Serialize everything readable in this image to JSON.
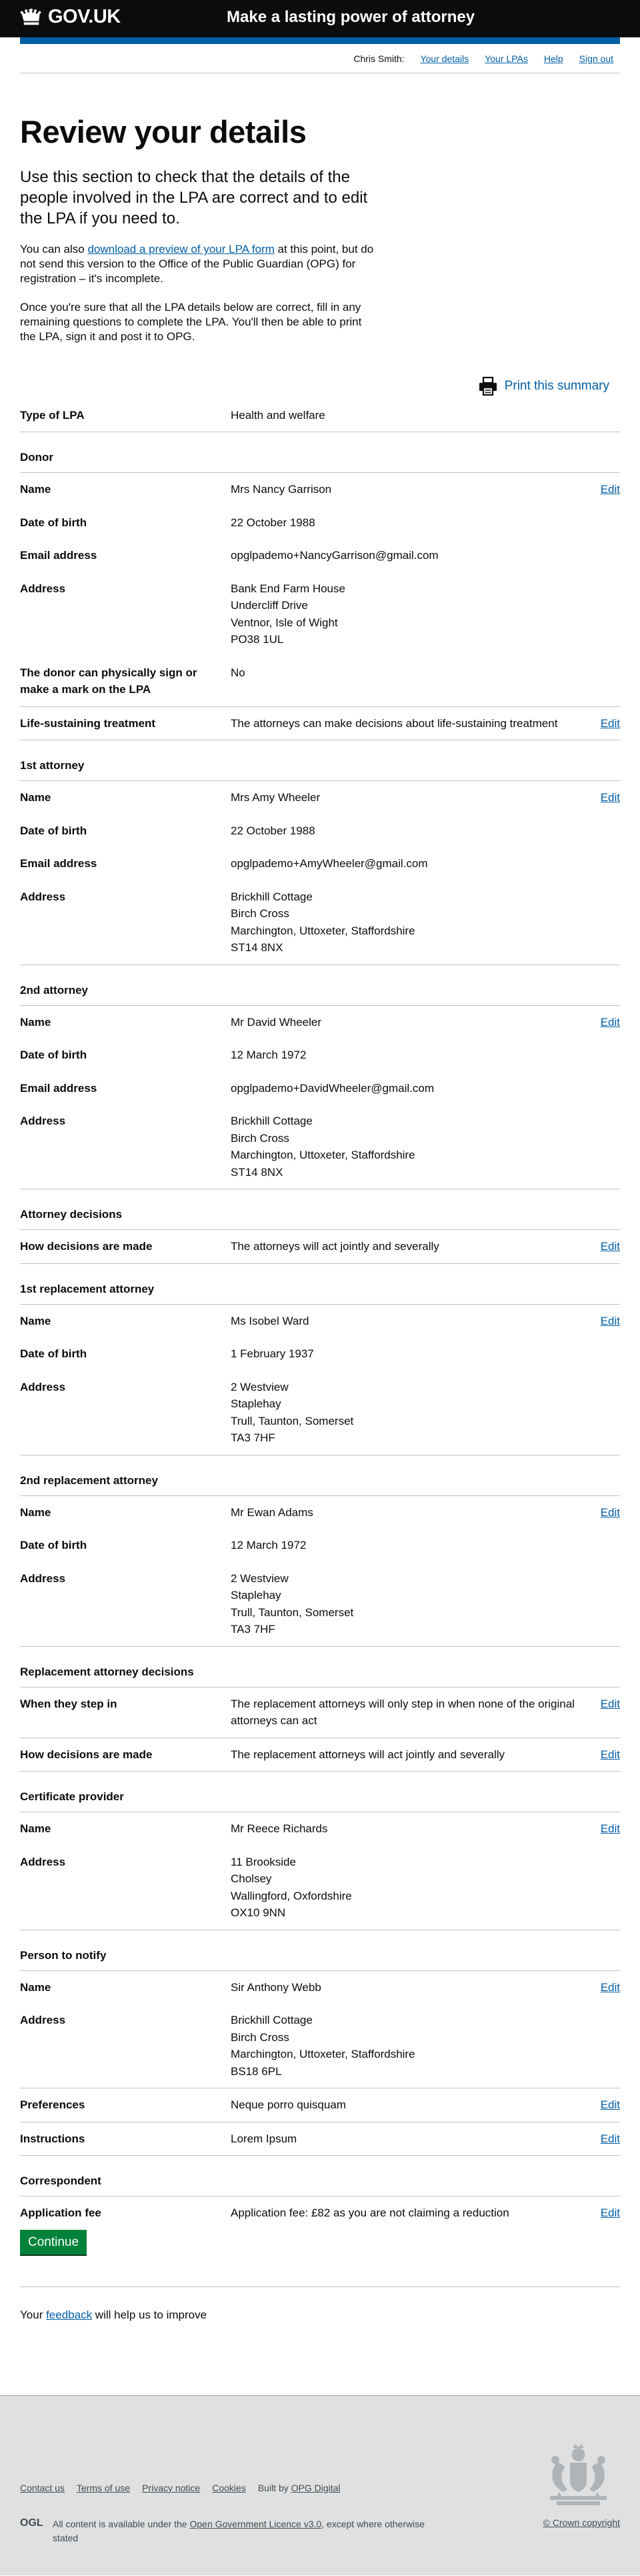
{
  "header": {
    "logo_text": "GOV.UK",
    "service_name": "Make a lasting power of attorney"
  },
  "user_nav": {
    "user_name": "Chris Smith:",
    "links": [
      "Your details",
      "Your LPAs",
      "Help",
      "Sign out"
    ]
  },
  "page": {
    "title": "Review your details",
    "lede": "Use this section to check that the details of the people involved in the LPA are correct and to edit the LPA if you need to.",
    "para1_before": "You can also ",
    "para1_link": "download a preview of your LPA form",
    "para1_after": " at this point, but do not send this version to the Office of the Public Guardian (OPG) for registration – it's incomplete.",
    "para2": "Once you're sure that all the LPA details below are correct, fill in any remaining questions to complete the LPA. You'll then be able to print the LPA, sign it and post it to OPG.",
    "print_label": "Print this summary",
    "edit_label": "Edit",
    "continue_label": "Continue",
    "feedback_before": "Your ",
    "feedback_link": "feedback",
    "feedback_after": " will help us to improve"
  },
  "type_of_lpa": {
    "label": "Type of LPA",
    "value": "Health and welfare"
  },
  "donor": {
    "heading": "Donor",
    "name": "Mrs Nancy Garrison",
    "dob": "22 October 1988",
    "email": "opglpademo+NancyGarrison@gmail.com",
    "address": [
      "Bank End Farm House",
      "Undercliff Drive",
      "Ventnor, Isle of Wight",
      "PO38 1UL"
    ],
    "sign_label": "The donor can physically sign or make a mark on the LPA",
    "sign_value": "No"
  },
  "life_sustaining": {
    "label": "Life-sustaining treatment",
    "value": "The attorneys can make decisions about life-sustaining treatment"
  },
  "labels": {
    "name": "Name",
    "dob": "Date of birth",
    "email": "Email address",
    "address": "Address"
  },
  "attorney1": {
    "heading": "1st attorney",
    "name": "Mrs Amy Wheeler",
    "dob": "22 October 1988",
    "email": "opglpademo+AmyWheeler@gmail.com",
    "address": [
      "Brickhill Cottage",
      "Birch Cross",
      "Marchington, Uttoxeter, Staffordshire",
      "ST14 8NX"
    ]
  },
  "attorney2": {
    "heading": "2nd attorney",
    "name": "Mr David Wheeler",
    "dob": "12 March 1972",
    "email": "opglpademo+DavidWheeler@gmail.com",
    "address": [
      "Brickhill Cottage",
      "Birch Cross",
      "Marchington, Uttoxeter, Staffordshire",
      "ST14 8NX"
    ]
  },
  "attorney_decisions": {
    "heading": "Attorney decisions",
    "label": "How decisions are made",
    "value": "The attorneys will act jointly and severally"
  },
  "replacement1": {
    "heading": "1st replacement attorney",
    "name": "Ms Isobel Ward",
    "dob": "1 February 1937",
    "address": [
      "2 Westview",
      "Staplehay",
      "Trull, Taunton, Somerset",
      "TA3 7HF"
    ]
  },
  "replacement2": {
    "heading": "2nd replacement attorney",
    "name": "Mr Ewan Adams",
    "dob": "12 March 1972",
    "address": [
      "2 Westview",
      "Staplehay",
      "Trull, Taunton, Somerset",
      "TA3 7HF"
    ]
  },
  "replacement_decisions": {
    "heading": "Replacement attorney decisions",
    "step_in_label": "When they step in",
    "step_in_value": "The replacement attorneys will only step in when none of the original attorneys can act",
    "how_label": "How decisions are made",
    "how_value": "The replacement attorneys will act jointly and severally"
  },
  "certificate_provider": {
    "heading": "Certificate provider",
    "name": "Mr Reece Richards",
    "address": [
      "11 Brookside",
      "Cholsey",
      "Wallingford, Oxfordshire",
      "OX10 9NN"
    ]
  },
  "person_to_notify": {
    "heading": "Person to notify",
    "name": "Sir Anthony Webb",
    "address": [
      "Brickhill Cottage",
      "Birch Cross",
      "Marchington, Uttoxeter, Staffordshire",
      "BS18 6PL"
    ]
  },
  "preferences": {
    "label": "Preferences",
    "value": "Neque porro quisquam"
  },
  "instructions": {
    "label": "Instructions",
    "value": "Lorem Ipsum"
  },
  "correspondent": {
    "heading": "Correspondent"
  },
  "application_fee": {
    "label": "Application fee",
    "value": "Application fee: £82 as you are not claiming a reduction"
  },
  "footer": {
    "links": [
      "Contact us",
      "Terms of use",
      "Privacy notice",
      "Cookies"
    ],
    "built_by_text": "Built by ",
    "built_by_link": "OPG Digital",
    "ogl_logo": "OGL",
    "licence_before": "All content is available under the ",
    "licence_link": "Open Government Licence v3.0",
    "licence_after": ", except where otherwise stated",
    "copyright": "© Crown copyright"
  },
  "colors": {
    "link": "#005ea5",
    "header_bg": "#0b0c0c",
    "button": "#00823b",
    "footer_bg": "#dee0e2"
  }
}
